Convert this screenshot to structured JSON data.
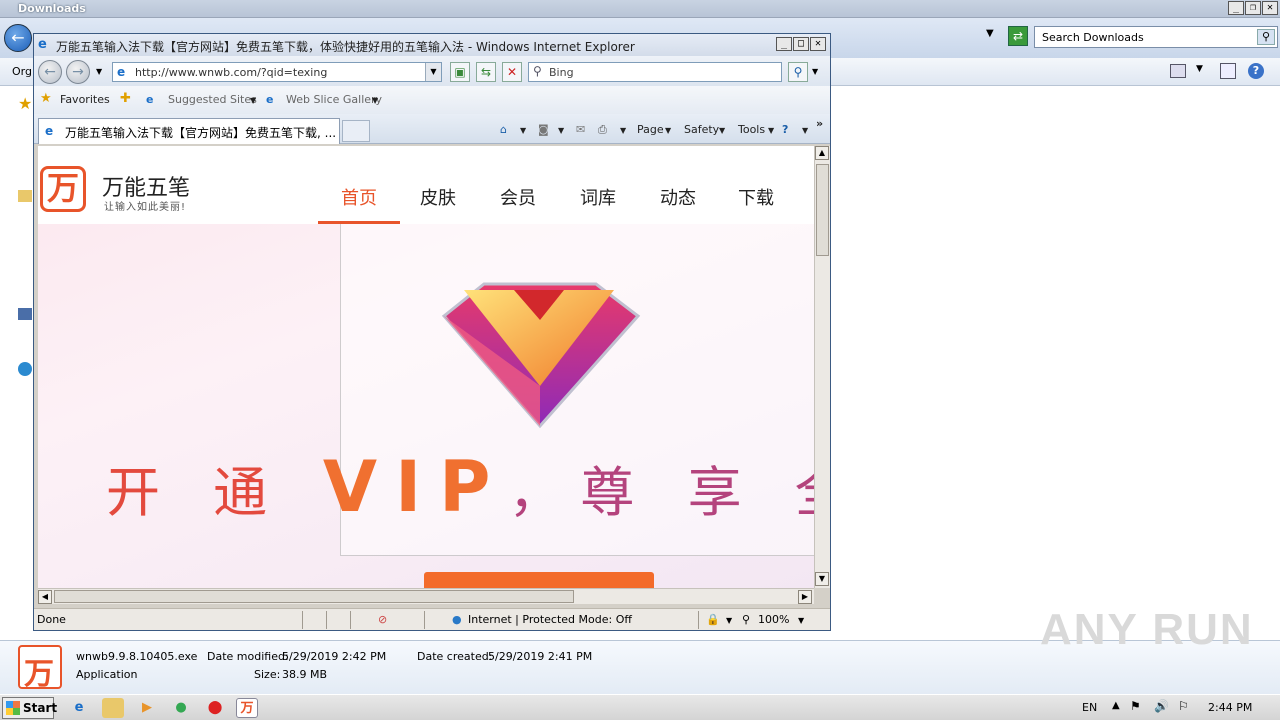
{
  "explorer": {
    "title": "Downloads",
    "search_placeholder": "Search Downloads",
    "org_label": "Org"
  },
  "file_details": {
    "name": "wnwb9.9.8.10405.exe",
    "type": "Application",
    "date_modified_label": "Date modified:",
    "date_modified": "5/29/2019 2:42 PM",
    "date_created_label": "Date created:",
    "date_created": "5/29/2019 2:41 PM",
    "size_label": "Size:",
    "size": "38.9 MB"
  },
  "ie": {
    "title": "万能五笔输入法下载【官方网站】免费五笔下载，体验快捷好用的五笔输入法 - Windows Internet Explorer",
    "url": "http://www.wnwb.com/?qid=texing",
    "search_placeholder": "Bing",
    "favorites_label": "Favorites",
    "suggested_sites": "Suggested Sites",
    "web_slice_gallery": "Web Slice Gallery",
    "tab_title": "万能五笔输入法下载【官方网站】免费五笔下载, ...",
    "page_menu": "Page",
    "safety_menu": "Safety",
    "tools_menu": "Tools",
    "status_text": "Done",
    "zone_text": "Internet | Protected Mode: Off",
    "zoom": "100%"
  },
  "site": {
    "brand": "万能五笔",
    "slogan": "让输入如此美丽!",
    "nav": [
      "首页",
      "皮肤",
      "会员",
      "词库",
      "动态",
      "下载"
    ],
    "hero_part1": "开 通",
    "hero_vip": "VIP",
    "hero_part2": "，尊 享 全 部"
  },
  "taskbar": {
    "start_label": "Start",
    "language": "EN",
    "time": "2:44 PM"
  },
  "watermark": "ANY RUN"
}
